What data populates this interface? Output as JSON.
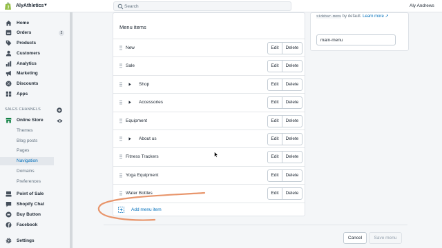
{
  "topbar": {
    "store_name": "AlyAthletics",
    "search_placeholder": "Search",
    "user_name": "Aly Andrews"
  },
  "sidebar": {
    "items": [
      {
        "label": "Home",
        "icon": "home-icon"
      },
      {
        "label": "Orders",
        "icon": "orders-icon",
        "badge": "2"
      },
      {
        "label": "Products",
        "icon": "tag-icon"
      },
      {
        "label": "Customers",
        "icon": "person-icon"
      },
      {
        "label": "Analytics",
        "icon": "chart-icon"
      },
      {
        "label": "Marketing",
        "icon": "megaphone-icon"
      },
      {
        "label": "Discounts",
        "icon": "discount-icon"
      },
      {
        "label": "Apps",
        "icon": "apps-icon"
      }
    ],
    "sales_channels_title": "SALES CHANNELS",
    "online_store": "Online Store",
    "online_store_sub": [
      "Themes",
      "Blog posts",
      "Pages",
      "Navigation",
      "Domains",
      "Preferences"
    ],
    "active_sub": "Navigation",
    "channels": [
      {
        "label": "Point of Sale",
        "icon": "pos-icon"
      },
      {
        "label": "Shopify Chat",
        "icon": "chat-icon"
      },
      {
        "label": "Buy Button",
        "icon": "buy-button-icon"
      },
      {
        "label": "Facebook",
        "icon": "facebook-icon"
      }
    ],
    "settings": "Settings"
  },
  "menu_card": {
    "title": "Menu items",
    "edit_label": "Edit",
    "delete_label": "Delete",
    "items": [
      {
        "name": "New",
        "expandable": false
      },
      {
        "name": "Sale",
        "expandable": false
      },
      {
        "name": "Shop",
        "expandable": true
      },
      {
        "name": "Accessories",
        "expandable": true
      },
      {
        "name": "Equipment",
        "expandable": false
      },
      {
        "name": "About us",
        "expandable": true
      },
      {
        "name": "Fitness Trackers",
        "expandable": false
      },
      {
        "name": "Yoga Equipment",
        "expandable": false
      },
      {
        "name": "Water Bottles",
        "expandable": false
      }
    ],
    "add_label": "Add menu item"
  },
  "handle_card": {
    "help_code_1": "sidebar-menu",
    "help_text_1": "by default.",
    "help_link": "Learn more",
    "handle_value": "main-menu"
  },
  "footer": {
    "cancel": "Cancel",
    "save": "Save menu"
  },
  "colors": {
    "link": "#006fbb",
    "annotation": "#e8956b",
    "brand": "#95bf47"
  }
}
